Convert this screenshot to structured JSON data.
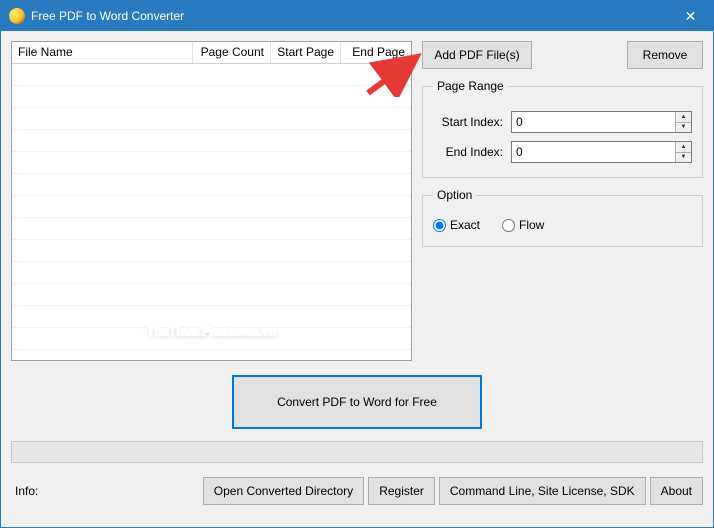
{
  "titlebar": {
    "title": "Free PDF to Word Converter"
  },
  "grid": {
    "columns": {
      "file": "File Name",
      "pagecount": "Page Count",
      "startpage": "Start Page",
      "endpage": "End Page"
    }
  },
  "buttons": {
    "add": "Add PDF File(s)",
    "remove": "Remove",
    "convert": "Convert PDF to Word for Free",
    "open_dir": "Open Converted Directory",
    "register": "Register",
    "cmdline": "Command Line, Site License, SDK",
    "about": "About"
  },
  "page_range": {
    "legend": "Page Range",
    "start_label": "Start Index:",
    "start_value": "0",
    "end_label": "End Index:",
    "end_value": "0"
  },
  "option": {
    "legend": "Option",
    "exact": "Exact",
    "flow": "Flow"
  },
  "info": {
    "label": "Info:"
  },
  "watermark": {
    "part1": "ThuThuat",
    "part2": "PhanMem.vn"
  }
}
